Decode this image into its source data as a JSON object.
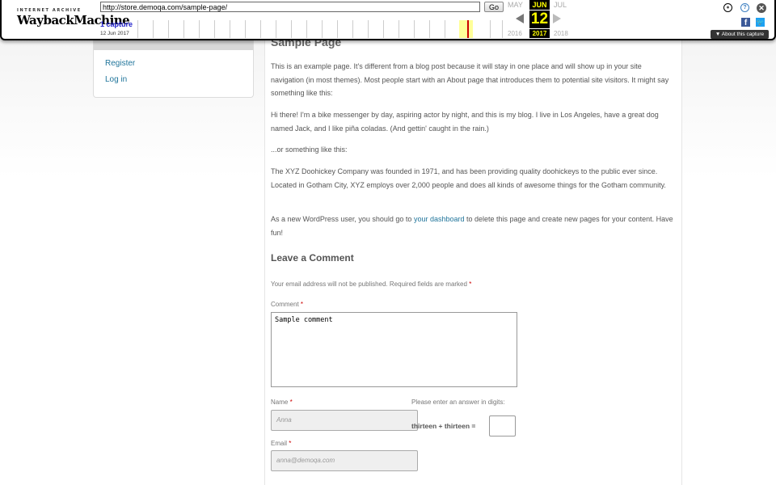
{
  "wayback": {
    "logo_top": "INTERNET ARCHIVE",
    "logo_main": "WaybackMachine",
    "url": "http://store.demoqa.com/sample-page/",
    "go_label": "Go",
    "captures": "1 capture",
    "capture_date": "12 Jun 2017",
    "month_prev": "MAY",
    "month_cur": "JUN",
    "month_next": "JUL",
    "day": "12",
    "year_prev": "2016",
    "year_cur": "2017",
    "year_next": "2018",
    "about": "▼ About this capture",
    "colors": {
      "highlight": "#ffff00",
      "brand_red": "#cc0000"
    }
  },
  "sidebar": {
    "links": [
      "Register",
      "Log in"
    ]
  },
  "page": {
    "title": "Sample Page",
    "p1": "This is an example page. It's different from a blog post because it will stay in one place and will show up in your site navigation (in most themes). Most people start with an About page that introduces them to potential site visitors. It might say something like this:",
    "p2": "Hi there! I'm a bike messenger by day, aspiring actor by night, and this is my blog. I live in Los Angeles, have a great dog named Jack, and I like piña coladas. (And gettin' caught in the rain.)",
    "p3": "...or something like this:",
    "p4": "The XYZ Doohickey Company was founded in 1971, and has been providing quality doohickeys to the public ever since. Located in Gotham City, XYZ employs over 2,000 people and does all kinds of awesome things for the Gotham community.",
    "p5_pre": "As a new WordPress user, you should go to ",
    "p5_link": "your dashboard",
    "p5_post": " to delete this page and create new pages for your content. Have fun!"
  },
  "comment_form": {
    "heading": "Leave a Comment",
    "notice": "Your email address will not be published. Required fields are marked",
    "req_mark": "*",
    "comment_label": "Comment",
    "comment_value": "Sample comment",
    "name_label": "Name",
    "name_placeholder": "Anna",
    "email_label": "Email",
    "email_placeholder": "anna@demoqa.com",
    "captcha_prompt": "Please enter an answer in digits:",
    "captcha_question": "thirteen + thirteen ="
  }
}
